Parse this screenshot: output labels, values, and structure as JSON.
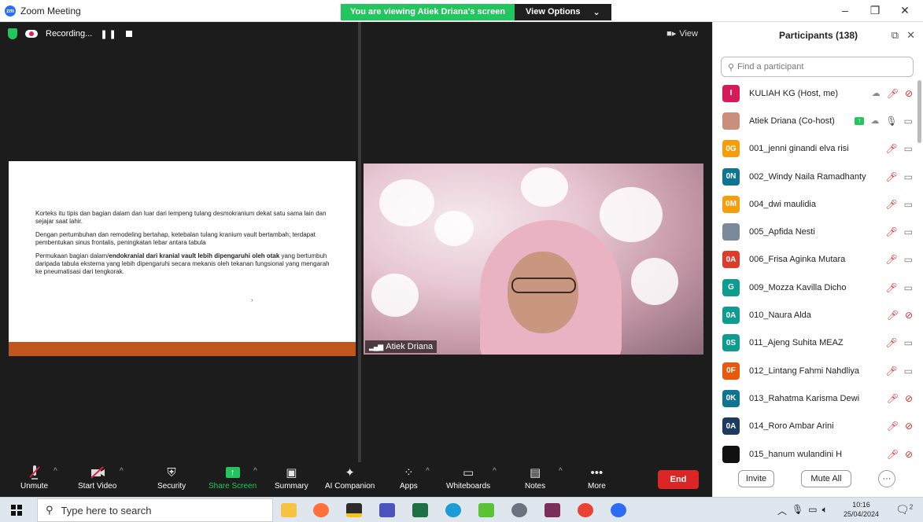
{
  "window": {
    "title": "Zoom Meeting",
    "share_banner": "You are viewing Atiek Driana's screen",
    "view_options": "View Options",
    "minimize": "–",
    "restore": "❐",
    "close": "✕"
  },
  "recording": {
    "label": "Recording...",
    "pause": "❚❚",
    "view_button": "View"
  },
  "slide": {
    "para1": "Korteks itu tipis dan bagian dalam dan luar dari lempeng tulang desmokranium dekat satu sama lain dan sejajar saat lahir.",
    "para2": "Dengan pertumbuhan dan remodeling bertahap, ketebalan tulang kranium vault bertambah; terdapat pembentukan sinus frontalis, peningkatan lebar antara tabula",
    "para3_pre": "Permukaan bagian dalam/",
    "para3_bold": "endokranial dari kranial vault lebih dipengaruhi oleh otak",
    "para3_post": " yang bertumbuh daripada tabula eksterna yang lebih dipengaruhi secara mekanis oleh tekanan fungsional yang mengarah ke pneumatisasi dari tengkorak.",
    "arrow": "›",
    "footer_color": "#c2541e"
  },
  "camera": {
    "name": "Atiek Driana",
    "signal": "▂▄▆"
  },
  "toolbar": {
    "unmute": "Unmute",
    "start_video": "Start Video",
    "security": "Security",
    "share_screen": "Share Screen",
    "summary": "Summary",
    "ai_companion": "AI Companion",
    "apps": "Apps",
    "whiteboards": "Whiteboards",
    "notes": "Notes",
    "more": "More",
    "end": "End",
    "caret": "^",
    "more_dots": "•••",
    "share_arrow": "↑"
  },
  "participants": {
    "title": "Participants (138)",
    "search_placeholder": "Find a participant",
    "invite": "Invite",
    "mute_all": "Mute All",
    "more": "···",
    "list": [
      {
        "initials": "I",
        "color": "#d61b5a",
        "name": "KULIAH KG (Host, me)"
      },
      {
        "initials": "",
        "color": "#c98f7d",
        "name": "Atiek Driana (Co-host)"
      },
      {
        "initials": "0G",
        "color": "#f59e0b",
        "name": "001_jenni ginandi elva risi"
      },
      {
        "initials": "0N",
        "color": "#0e7490",
        "name": "002_Windy Naila Ramadhanty"
      },
      {
        "initials": "0M",
        "color": "#f59e0b",
        "name": "004_dwi maulidia"
      },
      {
        "initials": "",
        "color": "#7a8a9a",
        "name": "005_Apfida Nesti"
      },
      {
        "initials": "0A",
        "color": "#dc3d2b",
        "name": "006_Frisa Aginka Mutara"
      },
      {
        "initials": "G",
        "color": "#0f9b8e",
        "name": "009_Mozza Kavilla Dicho"
      },
      {
        "initials": "0A",
        "color": "#0f9b8e",
        "name": "010_Naura Alda"
      },
      {
        "initials": "0S",
        "color": "#0f9b8e",
        "name": "011_Ajeng Suhita MEAZ"
      },
      {
        "initials": "0F",
        "color": "#ea580c",
        "name": "012_Lintang Fahmi Nahdliya"
      },
      {
        "initials": "0K",
        "color": "#0e7490",
        "name": "013_Rahatma Karisma Dewi"
      },
      {
        "initials": "0A",
        "color": "#1e3a5f",
        "name": "014_Roro Ambar Arini"
      },
      {
        "initials": "",
        "color": "#111111",
        "name": "015_hanum wulandini H"
      }
    ]
  },
  "taskbar": {
    "search_placeholder": "Type here to search",
    "time": "10:16",
    "date": "25/04/2024",
    "notif_count": "2"
  }
}
